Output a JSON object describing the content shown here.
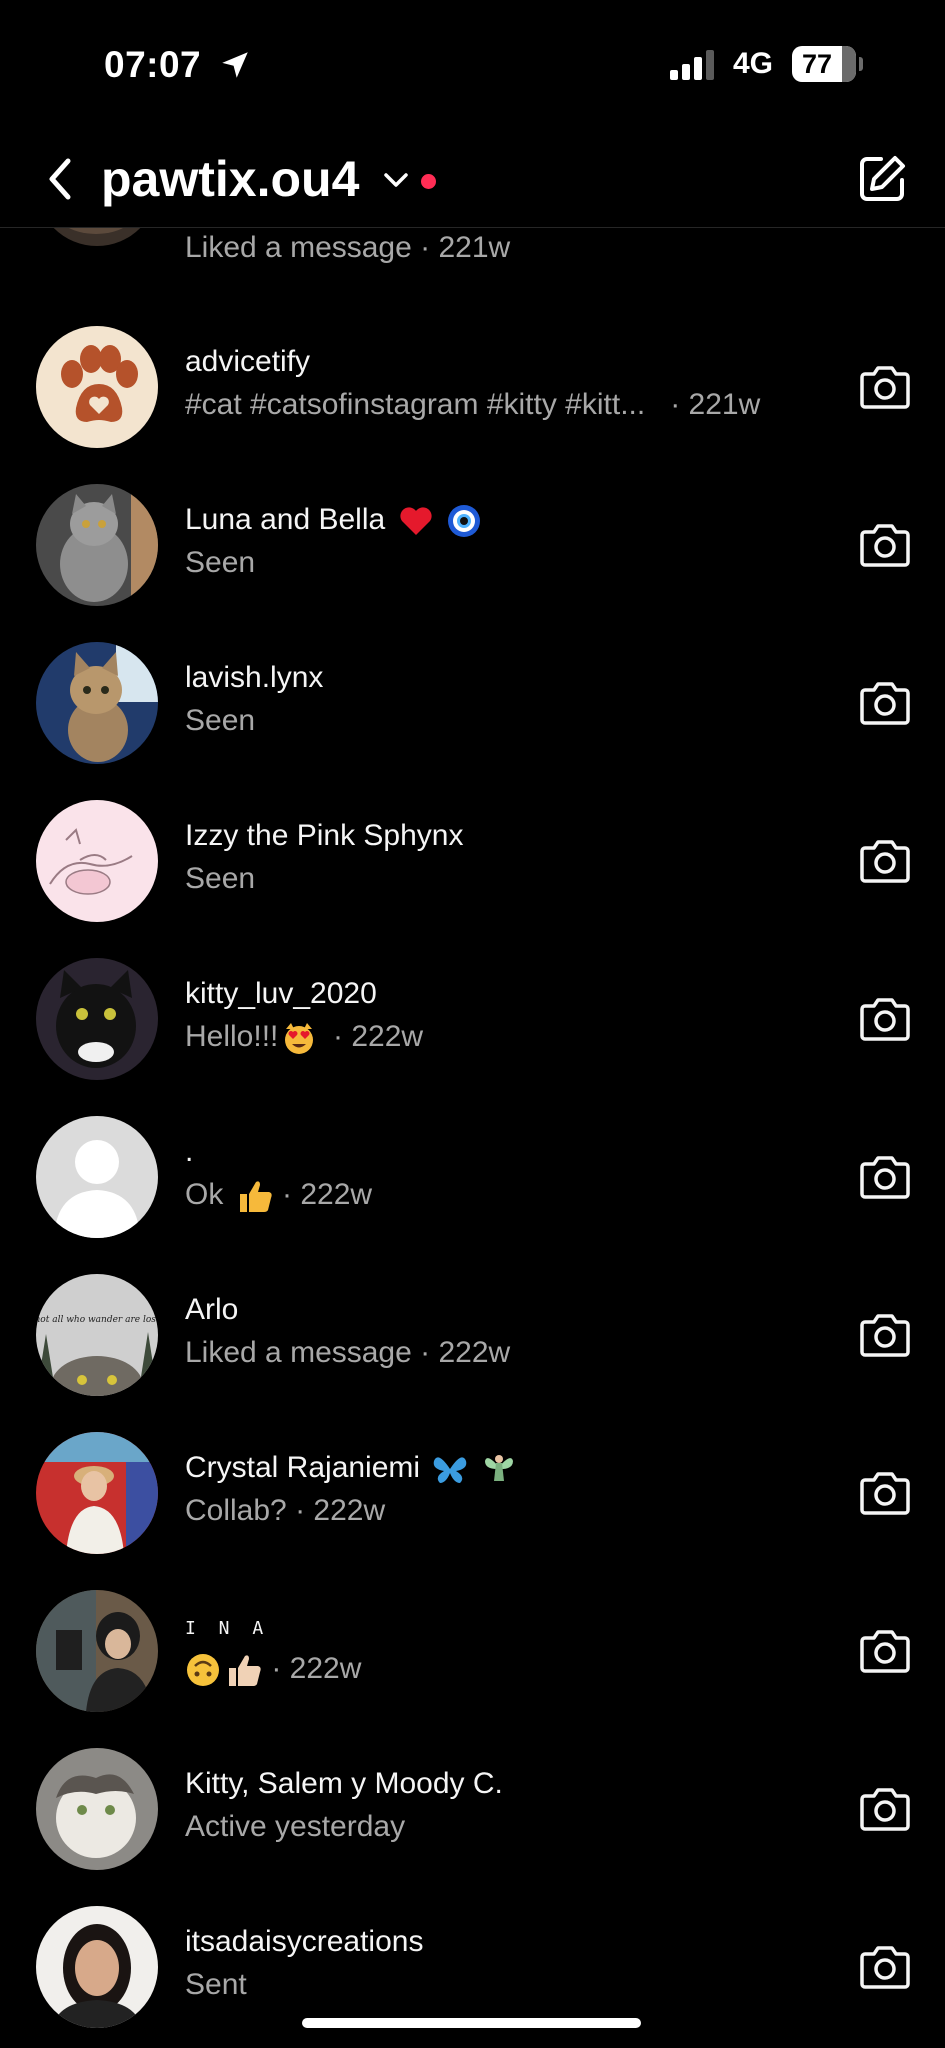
{
  "status_bar": {
    "time": "07:07",
    "network": "4G",
    "battery": "77"
  },
  "header": {
    "account_name": "pawtix.ou4",
    "icons": [
      "back-icon",
      "chevron-down-icon",
      "compose-icon"
    ]
  },
  "conversations": [
    {
      "name": "",
      "status": "Liked a message",
      "age": "· 221w"
    },
    {
      "name": "advicetify",
      "status": "#cat #catsofinstagram #kitty #kitt...",
      "age": "· 221w"
    },
    {
      "name": "Luna and Bella",
      "status": "Seen",
      "age": ""
    },
    {
      "name": "lavish.lynx",
      "status": "Seen",
      "age": ""
    },
    {
      "name": "Izzy the Pink Sphynx",
      "status": "Seen",
      "age": ""
    },
    {
      "name": "kitty_luv_2020",
      "status": "Hello!!!",
      "age": "· 222w"
    },
    {
      "name": ".",
      "status": "Ok",
      "age": "· 222w"
    },
    {
      "name": "Arlo",
      "status": "Liked a message",
      "age": "· 222w"
    },
    {
      "name": "Crystal Rajaniemi",
      "status": "Collab?",
      "age": "· 222w"
    },
    {
      "name": "I N A",
      "status": "",
      "age": "· 222w"
    },
    {
      "name": "Kitty, Salem y Moody C.",
      "status": "Active yesterday",
      "age": ""
    },
    {
      "name": "itsadaisycreations",
      "status": "Sent",
      "age": ""
    }
  ],
  "avatar_text": [
    "not all who wander are lost"
  ],
  "colors": {
    "background": "#000000",
    "secondary_text": "#a8a8a8",
    "notification_dot": "#ff2d55"
  }
}
